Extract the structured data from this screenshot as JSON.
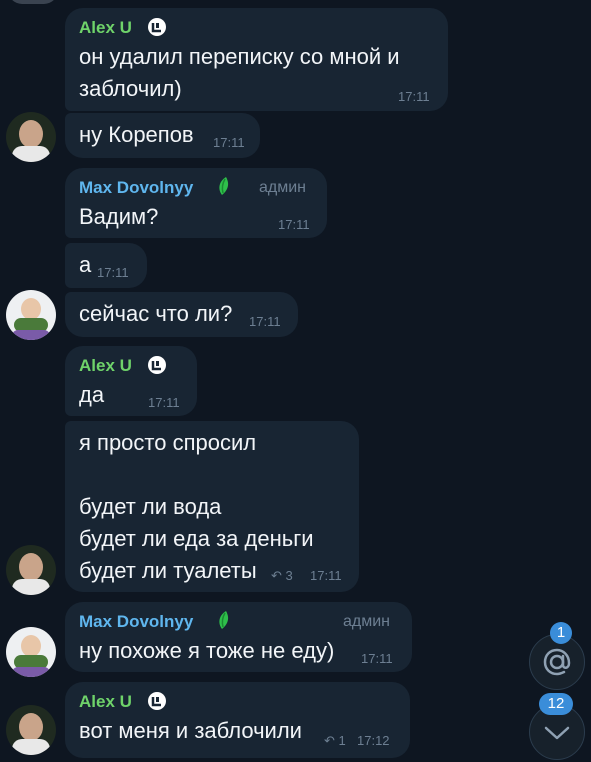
{
  "messages": [
    {
      "sender": "Alex U",
      "text": "он удалил переписку со мной и\nзаблочил)",
      "time": "17:11"
    },
    {
      "text": "ну Корепов",
      "time": "17:11"
    },
    {
      "sender": "Max Dovolnyy",
      "role": "админ",
      "text": "Вадим?",
      "time": "17:11"
    },
    {
      "text": "а",
      "time": "17:11"
    },
    {
      "text": "сейчас что ли?",
      "time": "17:11"
    },
    {
      "sender": "Alex U",
      "text": "да",
      "time": "17:11"
    },
    {
      "text": "я просто спросил\n\nбудет ли вода\nбудет ли еда за деньги\nбудет ли туалеты",
      "time": "17:11",
      "replies": "3"
    },
    {
      "sender": "Max Dovolnyy",
      "role": "админ",
      "text": "ну похоже я тоже не еду)",
      "time": "17:11"
    },
    {
      "sender": "Alex U",
      "text": "вот меня и заблочили",
      "time": "17:12",
      "replies": "1"
    }
  ],
  "mentions_button": {
    "icon": "at-icon",
    "count": "1"
  },
  "scroll_down_button": {
    "icon": "chevron-down-icon",
    "count": "12"
  },
  "colors": {
    "background": "#0e1621",
    "bubble": "#182533",
    "alex_name": "#6fd36a",
    "max_name": "#5fb6ee",
    "badge": "#3a8dd9"
  }
}
